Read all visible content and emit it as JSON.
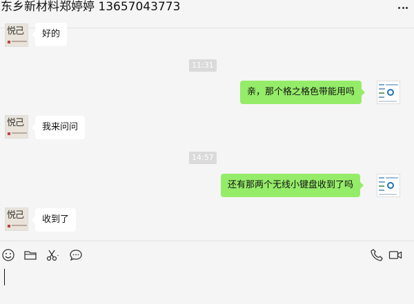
{
  "header": {
    "title": "东乡新材料郑婷婷 13657043773"
  },
  "messages": [
    {
      "text": "好的"
    },
    {
      "time": "11:31"
    },
    {
      "text": "亲，那个格之格色带能用吗"
    },
    {
      "text": "我来问问"
    },
    {
      "time": "14:57"
    },
    {
      "text": "还有那两个无线小键盘收到了吗"
    },
    {
      "text": "收到了"
    }
  ],
  "avatar": {
    "contact_glyph": "悦己"
  },
  "toolbar": {
    "left_icons": [
      "emoji-icon",
      "folder-icon",
      "scissors-icon",
      "chat-bubble-icon"
    ],
    "right_icons": [
      "phone-icon",
      "video-icon"
    ]
  },
  "colors": {
    "outgoing_bubble": "#95ec69",
    "incoming_bubble": "#ffffff",
    "background": "#f5f5f5"
  }
}
